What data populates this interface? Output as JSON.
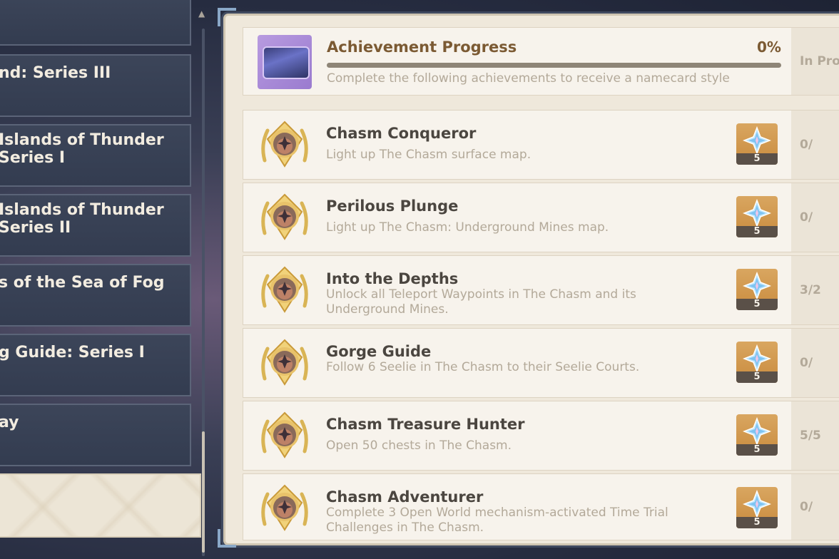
{
  "categories": [
    {
      "label_1": "",
      "label_2": ""
    },
    {
      "label_1": "nd: Series III",
      "label_2": ""
    },
    {
      "label_1": "Islands of Thunder",
      "label_2": " Series I"
    },
    {
      "label_1": "Islands of Thunder",
      "label_2": " Series II"
    },
    {
      "label_1": "s of the Sea of Fog",
      "label_2": ""
    },
    {
      "label_1": "g Guide: Series I",
      "label_2": ""
    },
    {
      "label_1": "ay",
      "label_2": ""
    },
    {
      "label_1": "",
      "label_2": ""
    }
  ],
  "progress": {
    "title": "Achievement Progress",
    "percent_text": "0%",
    "percent_value": 0,
    "description": "Complete the following achievements to receive a namecard style",
    "status": "In Pro"
  },
  "achievements": [
    {
      "title": "Chasm Conqueror",
      "description": "Light up The Chasm surface map.",
      "reward_qty": "5",
      "status": "0/"
    },
    {
      "title": "Perilous Plunge",
      "description": "Light up The Chasm: Underground Mines map.",
      "reward_qty": "5",
      "status": "0/"
    },
    {
      "title": "Into the Depths",
      "description": "Unlock all Teleport Waypoints in The Chasm and its Underground Mines.",
      "reward_qty": "5",
      "status": "3/2"
    },
    {
      "title": "Gorge Guide",
      "description": "Follow 6 Seelie in The Chasm to their Seelie Courts.",
      "reward_qty": "5",
      "status": "0/"
    },
    {
      "title": "Chasm Treasure Hunter",
      "description": "Open 50 chests in The Chasm.",
      "reward_qty": "5",
      "status": "5/5"
    },
    {
      "title": "Chasm Adventurer",
      "description": "Complete 3 Open World mechanism-activated Time Trial Challenges in The Chasm.",
      "reward_qty": "5",
      "status": "0/"
    }
  ],
  "icons": {
    "badge": "achievement-badge-icon",
    "reward": "primogem-icon",
    "namecard": "namecard-icon"
  },
  "colors": {
    "accent_gold": "#e9b45a",
    "title_brown": "#7b5a33",
    "reward_bg": "#d39a4e"
  }
}
